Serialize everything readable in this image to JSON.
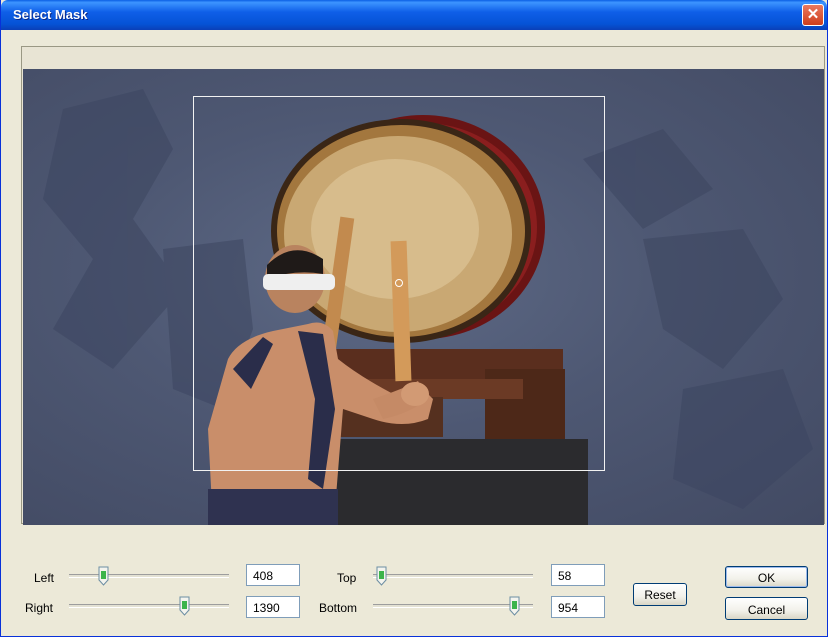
{
  "window": {
    "title": "Select Mask",
    "close_label": "✕"
  },
  "preview": {
    "image_description_icon": "taiko-drummer-image"
  },
  "controls": {
    "left": {
      "label": "Left",
      "value": "408",
      "level": 0.21
    },
    "right": {
      "label": "Right",
      "value": "1390",
      "level": 0.72
    },
    "top": {
      "label": "Top",
      "value": "58",
      "level": 0.05
    },
    "bottom": {
      "label": "Bottom",
      "value": "954",
      "level": 0.88
    }
  },
  "buttons": {
    "reset": "Reset",
    "ok": "OK",
    "cancel": "Cancel"
  },
  "colors": {
    "titlebar": "#0553d6",
    "window_bg": "#ece9d8",
    "close": "#cf3e1c"
  }
}
